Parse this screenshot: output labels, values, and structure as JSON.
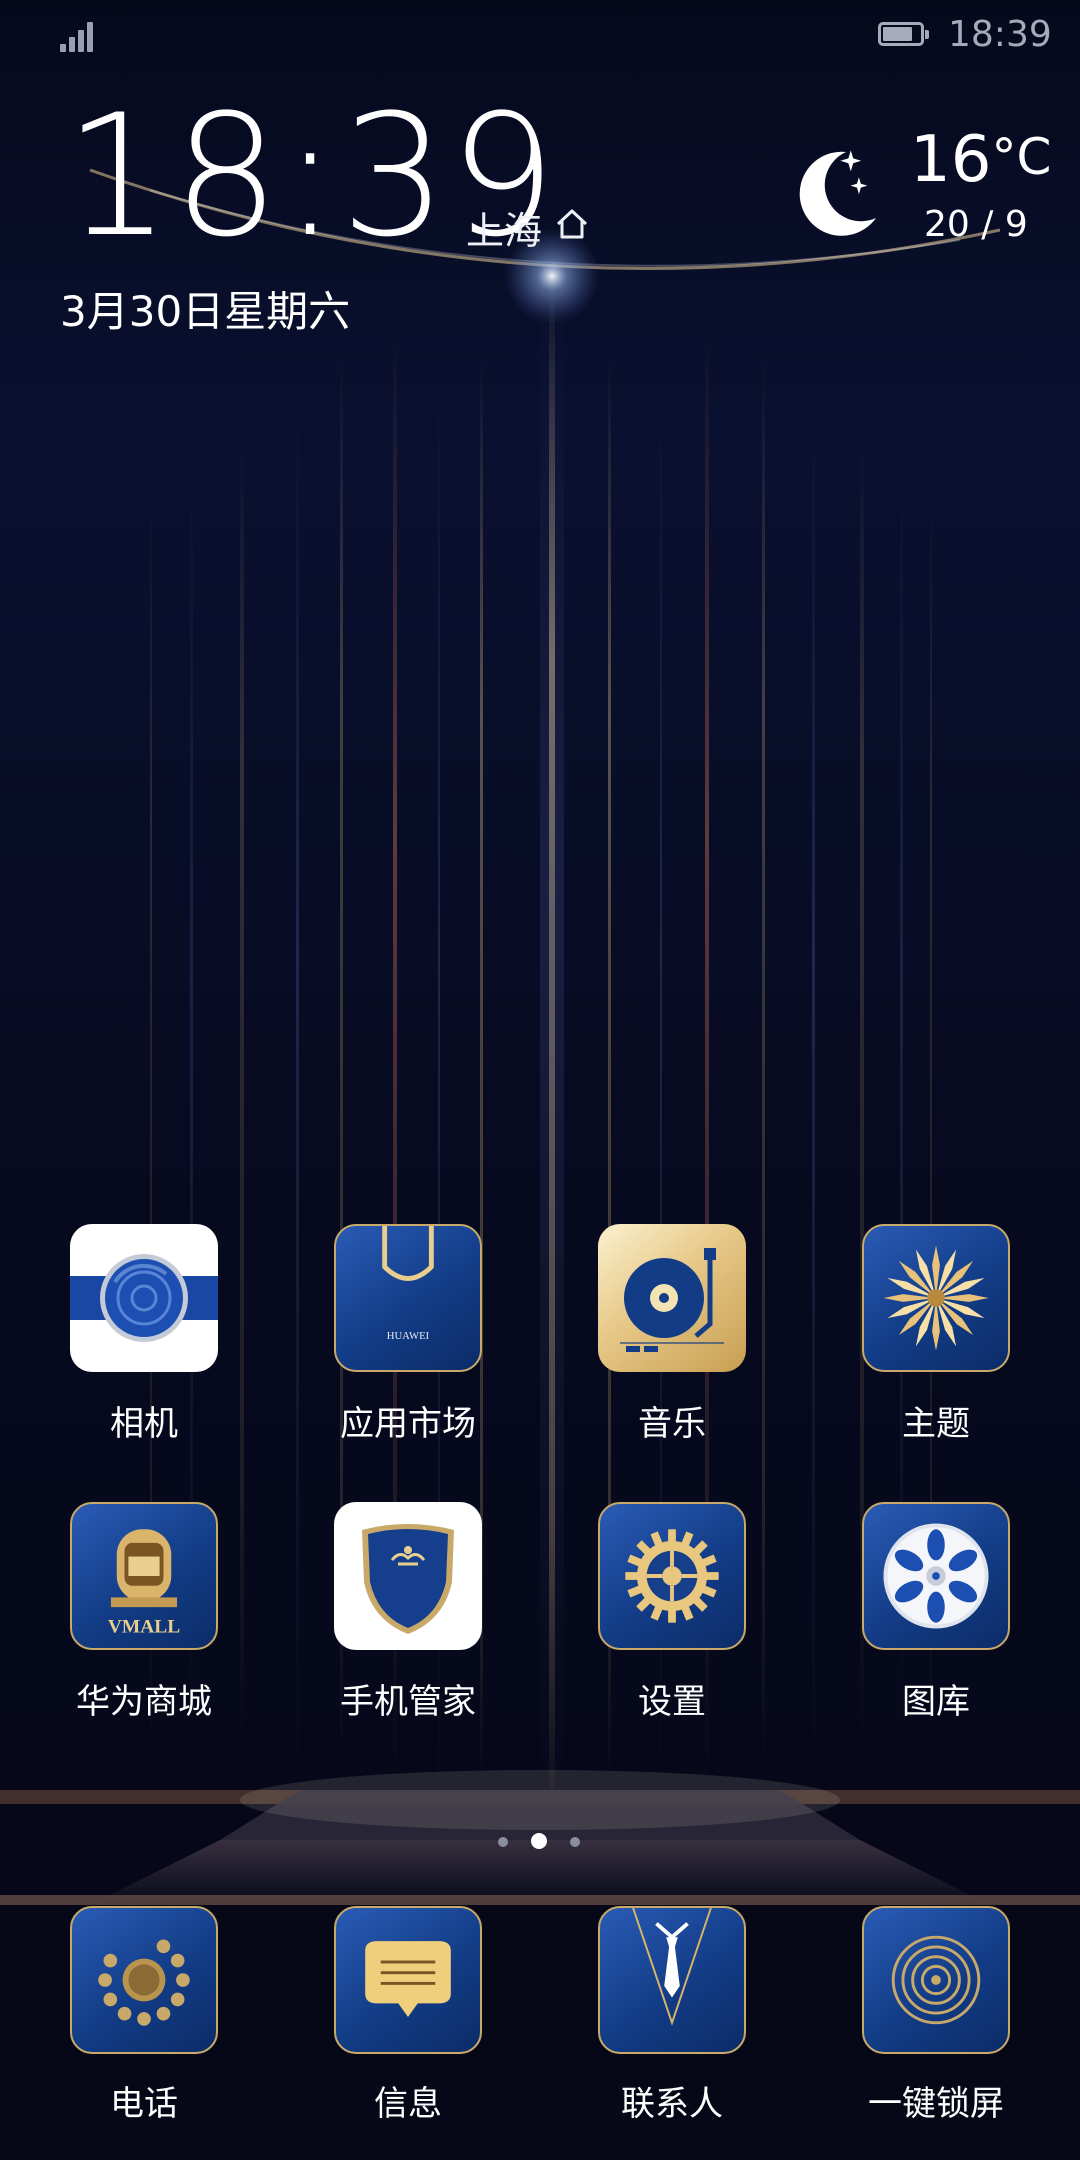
{
  "status_bar": {
    "time": "18:39",
    "battery_level": 0.8,
    "signal_bars": 4
  },
  "clock_widget": {
    "time": "18:39",
    "city": "上海",
    "date": "3月30日星期六"
  },
  "weather": {
    "icon": "moon-stars-icon",
    "temperature": "16",
    "unit": "°C",
    "range": "20 / 9"
  },
  "apps": [
    {
      "label": "相机",
      "icon": "camera-icon"
    },
    {
      "label": "应用市场",
      "icon": "shopping-bag-icon"
    },
    {
      "label": "音乐",
      "icon": "turntable-icon"
    },
    {
      "label": "主题",
      "icon": "flower-icon"
    },
    {
      "label": "华为商城",
      "icon": "vmall-icon"
    },
    {
      "label": "手机管家",
      "icon": "shield-icon"
    },
    {
      "label": "设置",
      "icon": "gear-icon"
    },
    {
      "label": "图库",
      "icon": "film-reel-icon"
    }
  ],
  "app_text": {
    "appmarket_badge": "HUAWEI",
    "vmall_badge": "VMALL"
  },
  "pager": {
    "total": 3,
    "current_index": 1
  },
  "dock": [
    {
      "label": "电话",
      "icon": "rotary-phone-icon"
    },
    {
      "label": "信息",
      "icon": "message-bubble-icon"
    },
    {
      "label": "联系人",
      "icon": "suit-tie-icon"
    },
    {
      "label": "一键锁屏",
      "icon": "lock-rings-icon"
    }
  ],
  "colors": {
    "accent_gold": "#c9a96a",
    "tile_blue": "#123c86",
    "background": "#06091c"
  }
}
